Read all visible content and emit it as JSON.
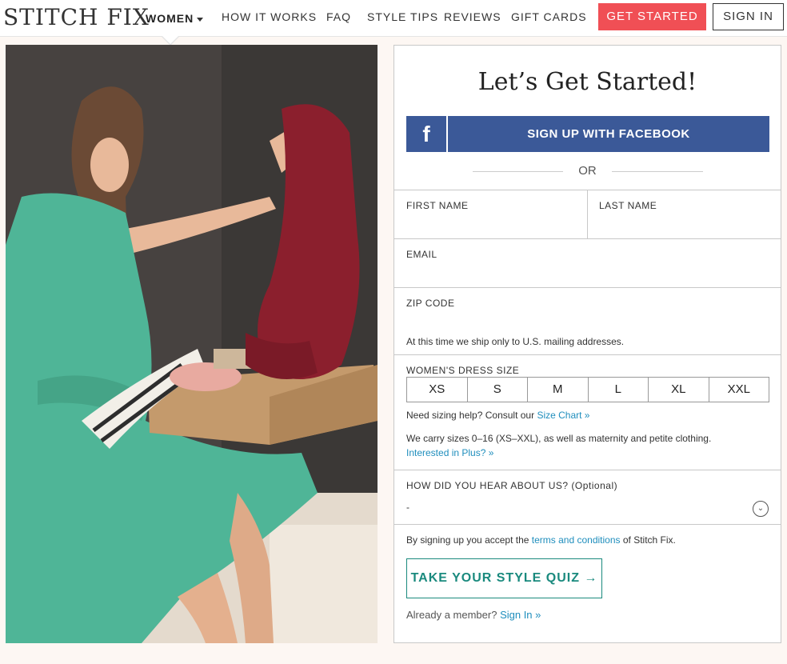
{
  "header": {
    "logo": "STITCH FIX",
    "category": "WOMEN",
    "nav": [
      "HOW IT WORKS",
      "FAQ",
      "STYLE TIPS",
      "REVIEWS",
      "GIFT CARDS"
    ],
    "get_started": "GET STARTED",
    "sign_in": "SIGN IN"
  },
  "form": {
    "title": "Let’s Get Started!",
    "facebook_icon": "f",
    "facebook_button": "SIGN UP WITH FACEBOOK",
    "or": "OR",
    "first_name_label": "FIRST NAME",
    "last_name_label": "LAST NAME",
    "email_label": "EMAIL",
    "zip_label": "ZIP CODE",
    "zip_note": "At this time we ship only to U.S. mailing addresses.",
    "dress_size_label": "WOMEN'S DRESS SIZE",
    "sizes": [
      "XS",
      "S",
      "M",
      "L",
      "XL",
      "XXL"
    ],
    "sizing_help_prefix": "Need sizing help? Consult our ",
    "size_chart_link": "Size Chart »",
    "sizes_note": "We carry sizes 0–16 (XS–XXL), as well as maternity and petite clothing.",
    "plus_link": "Interested in Plus? »",
    "hear_label": "HOW DID YOU HEAR ABOUT US? (Optional)",
    "hear_value": "-",
    "terms_prefix": "By signing up you accept the ",
    "terms_link": "terms and conditions",
    "terms_suffix": " of Stitch Fix.",
    "quiz_button": "TAKE YOUR STYLE QUIZ →",
    "member_prefix": "Already a member? ",
    "member_link": "Sign In »"
  },
  "icons": {
    "dropdown": "chevron-down-circle-icon",
    "facebook": "facebook-icon",
    "caret": "caret-down-icon"
  },
  "colors": {
    "accent": "#f04f55",
    "facebook": "#3b5998",
    "teal": "#1a8a7e",
    "link": "#1f8ebd"
  }
}
